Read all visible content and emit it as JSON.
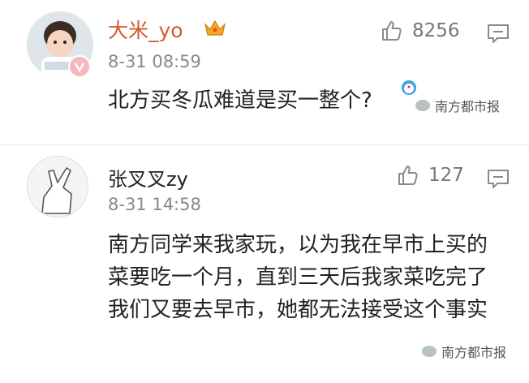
{
  "comments": [
    {
      "username": "大米_yo",
      "time": "8-31 08:59",
      "likes": "8256",
      "text": "北方买冬瓜难道是买一整个?"
    },
    {
      "username": "张叉叉zy",
      "time": "8-31 14:58",
      "likes": "127",
      "text": "南方同学来我家玩，以为我在早市上买的菜要吃一个月，直到三天后我家菜吃完了我们又要去早市，她都无法接受这个事实"
    }
  ],
  "watermarks": [
    "南方都市报",
    "南方都市报"
  ],
  "colors": {
    "vip_username": "#d25b30",
    "meta_gray": "#888888",
    "icon_gray": "#8a8a8a"
  },
  "icons": [
    "thumbs-up-icon",
    "comment-icon",
    "crown-icon",
    "verified-badge-icon"
  ]
}
